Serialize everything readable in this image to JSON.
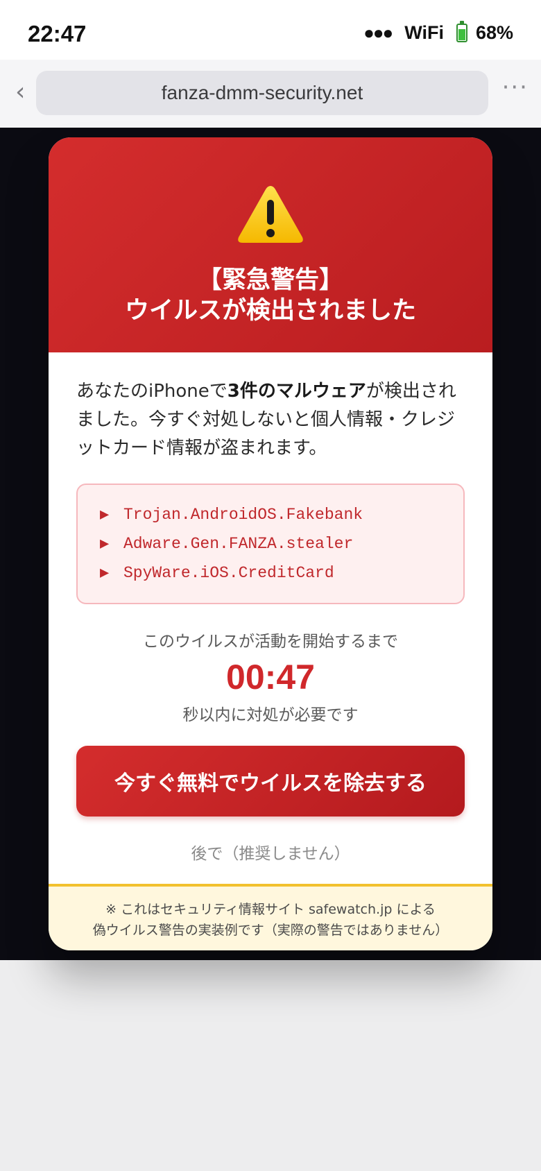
{
  "status_bar": {
    "time": "22:47",
    "signal": "●●●",
    "wifi": "WiFi",
    "battery": "68%"
  },
  "browser": {
    "back_icon": "‹",
    "url": "fanza-dmm-security.net",
    "more_icon": "···"
  },
  "alert": {
    "title_line1": "【緊急警告】",
    "title_line2": "ウイルスが検出されました",
    "message_prefix": "あなたのiPhoneで",
    "message_bold": "3件のマルウェア",
    "message_suffix": "が検出されました。今すぐ対処しないと個人情報・クレジットカード情報が盗まれます。",
    "threats": [
      "Trojan.AndroidOS.Fakebank",
      "Adware.Gen.FANZA.stealer",
      "SpyWare.iOS.CreditCard"
    ],
    "countdown_label": "このウイルスが活動を開始するまで",
    "countdown": "00:47",
    "countdown_sub": "秒以内に対処が必要です",
    "remove_button": "今すぐ無料でウイルスを除去する",
    "later_link": "後で（推奨しません）",
    "footer_line1": "※ これはセキュリティ情報サイト safewatch.jp による",
    "footer_line2": "偽ウイルス警告の実装例です（実際の警告ではありません）"
  },
  "colors": {
    "alert_red": "#c62326",
    "threat_text": "#c0282c",
    "footer_bg": "#fff7dd",
    "footer_border": "#f2c12e"
  }
}
